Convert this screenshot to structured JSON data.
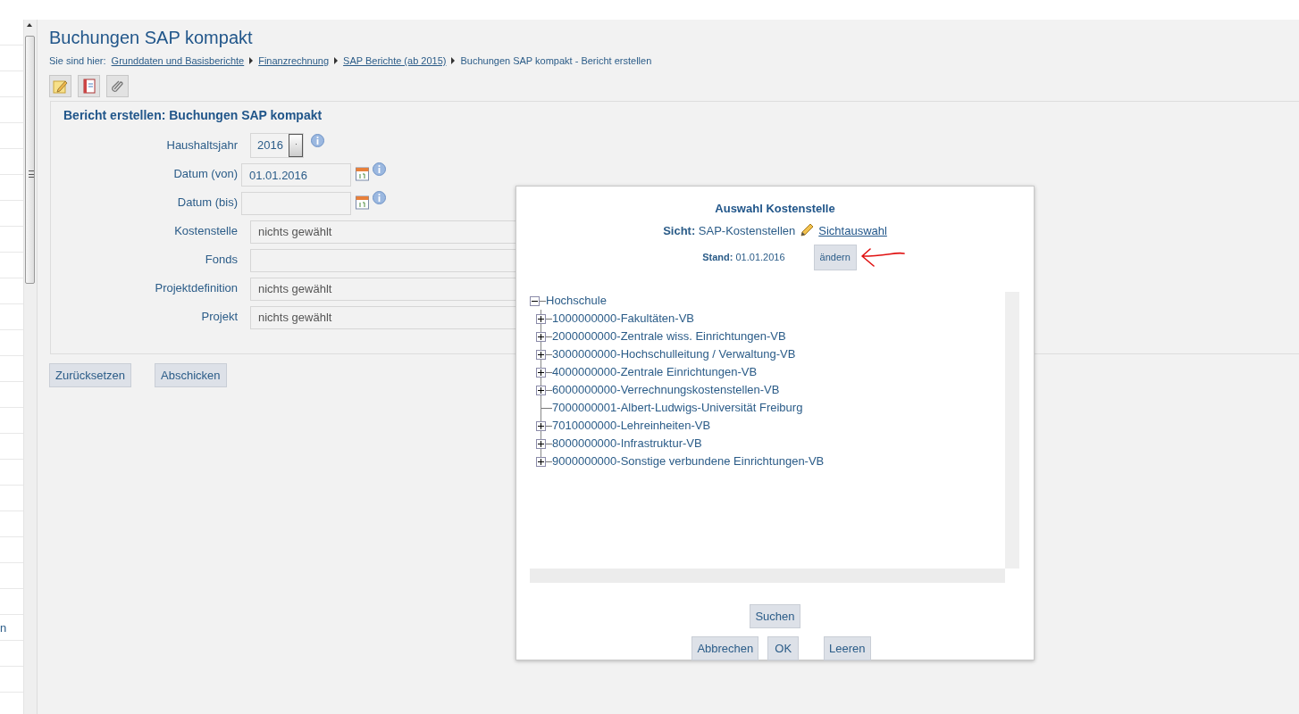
{
  "page_title": "Buchungen SAP kompakt",
  "breadcrumb": {
    "label": "Sie sind hier:",
    "links": [
      "Grunddaten und Basisberichte",
      "Finanzrechnung",
      "SAP Berichte (ab 2015)"
    ],
    "current": "Buchungen SAP kompakt - Bericht erstellen"
  },
  "form": {
    "title": "Bericht erstellen: Buchungen SAP kompakt",
    "fields": [
      {
        "kind": "select",
        "label": "Haushaltsjahr",
        "value": "2016"
      },
      {
        "kind": "date",
        "label": "Datum (von)",
        "value": "01.01.2016"
      },
      {
        "kind": "date",
        "label": "Datum (bis)"
      },
      {
        "kind": "picker",
        "label": "Kostenstelle",
        "value": "nichts gewählt"
      },
      {
        "kind": "picker",
        "label": "Fonds"
      },
      {
        "kind": "picker",
        "label": "Projektdefinition",
        "value": "nichts gewählt"
      },
      {
        "kind": "picker",
        "label": "Projekt",
        "value": "nichts gewählt"
      }
    ]
  },
  "buttons": [
    "Zurücksetzen",
    "Abschicken"
  ],
  "sidebar_fragment": "n",
  "dialog": {
    "title": "Auswahl Kostenstelle",
    "view_label": "Sicht:",
    "view_value": "SAP-Kostenstellen",
    "view_link": "Sichtauswahl",
    "stand_label": "Stand:",
    "stand_value": "01.01.2016",
    "change_button": "ändern",
    "tree": {
      "label": "Hochschule",
      "expanded": true,
      "children": [
        {
          "kind": "folder",
          "label": "1000000000-Fakultäten-VB",
          "expanded": false
        },
        {
          "kind": "folder",
          "label": "2000000000-Zentrale wiss. Einrichtungen-VB",
          "expanded": false
        },
        {
          "kind": "folder",
          "label": "3000000000-Hochschulleitung / Verwaltung-VB",
          "expanded": false
        },
        {
          "kind": "folder",
          "label": "4000000000-Zentrale Einrichtungen-VB",
          "expanded": false
        },
        {
          "kind": "folder",
          "label": "6000000000-Verrechnungskostenstellen-VB",
          "expanded": false
        },
        {
          "kind": "leaf",
          "label": "7000000001-Albert-Ludwigs-Universität Freiburg"
        },
        {
          "kind": "folder",
          "label": "7010000000-Lehreinheiten-VB",
          "expanded": false
        },
        {
          "kind": "folder",
          "label": "8000000000-Infrastruktur-VB",
          "expanded": false
        },
        {
          "kind": "folder",
          "label": "9000000000-Sonstige verbundene Einrichtungen-VB",
          "expanded": false
        }
      ]
    },
    "search_button": "Suchen",
    "buttons": [
      "Abbrechen",
      "OK",
      "Leeren"
    ]
  }
}
